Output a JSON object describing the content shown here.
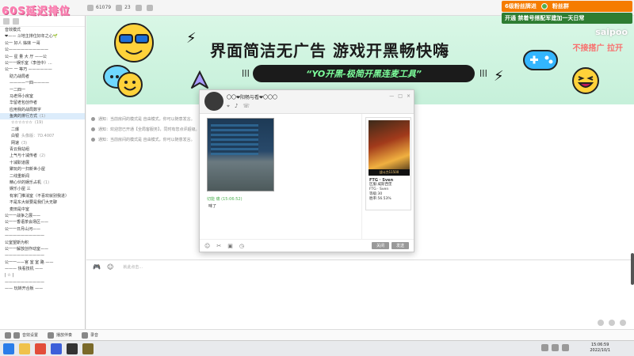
{
  "overlay": {
    "title": "60S延迟排位",
    "promo_line1": "6级粉丝牌进",
    "promo_line1b": "粉丝群",
    "promo_line2": "开通 禁着号搭配军建加一天日常",
    "watermark": "saipoo",
    "watermark2": "不接搭广 拉开"
  },
  "topbar": {
    "count1": "61079",
    "count2": "23"
  },
  "sidebar": {
    "items": [
      {
        "label": "音效模式",
        "extra": "",
        "indent": 0
      },
      {
        "label": "❤—— 斗地主排位好年之心🌱",
        "extra": "",
        "indent": 0
      },
      {
        "label": "公一 好人 姊妹 一哥",
        "extra": "",
        "indent": 0
      },
      {
        "label": "公——————————",
        "extra": "",
        "indent": 0
      },
      {
        "label": "公—  星 量 大 厅 ——公",
        "extra": "",
        "indent": 0
      },
      {
        "label": "公一一娱乐室（李佳中）...",
        "extra": "",
        "indent": 0
      },
      {
        "label": "公一 一 等巧 ——————",
        "extra": "",
        "indent": 0
      },
      {
        "label": "助力战局者",
        "extra": "",
        "indent": 1
      },
      {
        "label": "————一四————",
        "extra": "",
        "indent": 1
      },
      {
        "label": "一二四一",
        "extra": "",
        "indent": 1
      },
      {
        "label": "马老师小房室",
        "extra": "",
        "indent": 1
      },
      {
        "label": "华留老包创作者",
        "extra": "",
        "indent": 1
      },
      {
        "label": "应用我的战局数字",
        "extra": "",
        "indent": 1
      },
      {
        "label": "鱼爽的排行方式",
        "extra": "(1)",
        "indent": 1,
        "active": true
      },
      {
        "label": "☆☆☆☆☆☆",
        "extra": "(19)",
        "indent": 2
      },
      {
        "label": "二爆",
        "extra": "",
        "indent": 2
      },
      {
        "label": "白银",
        "extra": "头像版：7D.4007",
        "indent": 2
      },
      {
        "label": "网速",
        "extra": "(3)",
        "indent": 2
      },
      {
        "label": "青云我站组",
        "extra": "",
        "indent": 1
      },
      {
        "label": "上气与十减传者",
        "extra": "(2)",
        "indent": 1
      },
      {
        "label": "十减职道展",
        "extra": "",
        "indent": 1
      },
      {
        "label": "聚玩的一扫新世小屋",
        "extra": "",
        "indent": 1
      },
      {
        "label": "二线重新闻",
        "extra": "",
        "indent": 1
      },
      {
        "label": "精心伙的娱乐占机",
        "extra": "(1)",
        "indent": 1
      },
      {
        "label": "娱乐小屋 三",
        "extra": "",
        "indent": 1
      },
      {
        "label": "有家门推消室（不喜欢就别我进）",
        "extra": "",
        "indent": 1
      },
      {
        "label": "不是东大就要是我们大无聊",
        "extra": "",
        "indent": 1
      },
      {
        "label": "麦田是中室",
        "extra": "",
        "indent": 1
      },
      {
        "label": "公一一战争之展——",
        "extra": "",
        "indent": 0
      },
      {
        "label": "公一一香语茶会场区——",
        "extra": "",
        "indent": 0
      },
      {
        "label": "公一一日月山河——",
        "extra": "",
        "indent": 0
      },
      {
        "label": "——————————",
        "extra": "",
        "indent": 0
      },
      {
        "label": "公室望斯为积",
        "extra": "",
        "indent": 0
      },
      {
        "label": "公一一解放创作动室——",
        "extra": "",
        "indent": 0
      },
      {
        "label": "——————————",
        "extra": "",
        "indent": 0
      },
      {
        "label": "公一一——官 室 室 路 ——",
        "extra": "",
        "indent": 0
      },
      {
        "label": "———  快看技机  ——",
        "extra": "",
        "indent": 0
      },
      {
        "label": "|  ☆  |",
        "extra": "",
        "indent": 0
      },
      {
        "label": "——————————",
        "extra": "",
        "indent": 0
      },
      {
        "label": "——  玩转开合板 ——",
        "extra": "",
        "indent": 0
      }
    ]
  },
  "banner": {
    "headline": "界面简洁无广告  游戏开黑畅快嗨",
    "slogan": "“YO开黑-极简开黑连麦工具”",
    "bars_left": "|||",
    "bars_right": "|||"
  },
  "messages": [
    {
      "text": "通知：当前房间的模式是 自由模式，你可以随意发言。",
      "link": "【"
    },
    {
      "text": "通知：欢迎您已开通【全局客服务】，同时有您点评超级。",
      "link": "【"
    },
    {
      "text": "通知：当前房间的模式是 自由模式，你可以随意发言。",
      "link": "【"
    }
  ],
  "popup": {
    "name": "〇〇❤阳畅与看❤〇〇〇",
    "sender": "切能 痛 (15:06:52)",
    "reply": "味了",
    "btn_close": "关闭",
    "btn_send": "发送",
    "card": {
      "art_caption": "战斗力11500",
      "title": "FTG · Sven",
      "line1": "区服:威斯西堡",
      "line2": "FTG · Sven",
      "line3": "等级:30",
      "line4": "胜率:56.53%"
    }
  },
  "input": {
    "placeholder": "就此点击..."
  },
  "subbar": {
    "item1": "音效设置",
    "item2": "播放伴奏",
    "item3": "录音"
  },
  "taskbar": {
    "time": "15:06:59",
    "date": "2022/10/1"
  },
  "colors": {
    "banner_bg": "#c6f0da",
    "pill_text": "#7dff9c",
    "overlay_title": "#ff7ab0",
    "promo_orange": "#f57c00",
    "promo_green": "#2e7d32"
  }
}
